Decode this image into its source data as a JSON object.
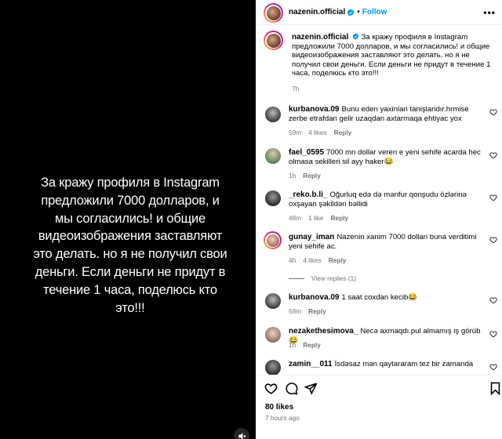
{
  "media": {
    "text": "За кражу профиля в Instagram предложили 7000 долларов, и мы согласились! и общие видеоизображения заставляют это делать. но я не получил свои деньги. Если деньги не придут в течение 1 часа, поделюсь кто это!!!"
  },
  "header": {
    "username": "nazenin.official",
    "dot": "•",
    "follow_label": "Follow",
    "more": "•••"
  },
  "caption": {
    "username": "nazenin.official",
    "text": "За кражу профиля в Instagram предложили 7000 долларов, и мы согласились! и общие видеоизображения заставляют это делать. но я не получил свои деньги. Если деньги не придут в течение 1 часа, поделюсь кто это!!!",
    "time": "7h"
  },
  "comments": [
    {
      "username": "kurbanova.09",
      "text": "Bunu eden yaxinlari tanişlaridır.hrmise zerbe etrafdan gelir uzaqdan axtarmaqa ehtiyac yox",
      "time": "59m",
      "likes": "4 likes",
      "reply": "Reply"
    },
    {
      "username": "fael_0595",
      "text": "7000 mn dollar veren e yeni sehife acarda hec olmasa sekilleri sil ayy haker😂",
      "time": "1h",
      "likes": "",
      "reply": "Reply"
    },
    {
      "username": "_reko.b.li_",
      "text": "Oğurluq edə də mənfur qonşudu özlərinə oxşayan şəkildən bəllidi",
      "time": "48m",
      "likes": "1 like",
      "reply": "Reply"
    },
    {
      "username": "gunay_iman",
      "text": "Nazenin xanim 7000 dollari buna verditimi yeni sehife ac.",
      "time": "4h",
      "likes": "4 likes",
      "reply": "Reply"
    },
    {
      "username": "kurbanova.09",
      "text": "1 saat coxdan kecib😂",
      "time": "58m",
      "likes": "",
      "reply": "Reply"
    },
    {
      "username": "nezakethesimova_",
      "text": "Necə axmaqdı.pul almamış iş görüb😂",
      "time": "1h",
      "likes": "",
      "reply": "Reply"
    },
    {
      "username": "zamin__011",
      "text": "İsdəsaz mən qaytararam tez bir zamanda",
      "time": "",
      "likes": "",
      "reply": ""
    }
  ],
  "view_replies": "View replies (1)",
  "footer": {
    "likes": "80 likes",
    "time_ago": "7 hours ago"
  },
  "colors": {
    "link_blue": "#0095f6",
    "muted": "#737373",
    "verified": "#0095f6"
  }
}
